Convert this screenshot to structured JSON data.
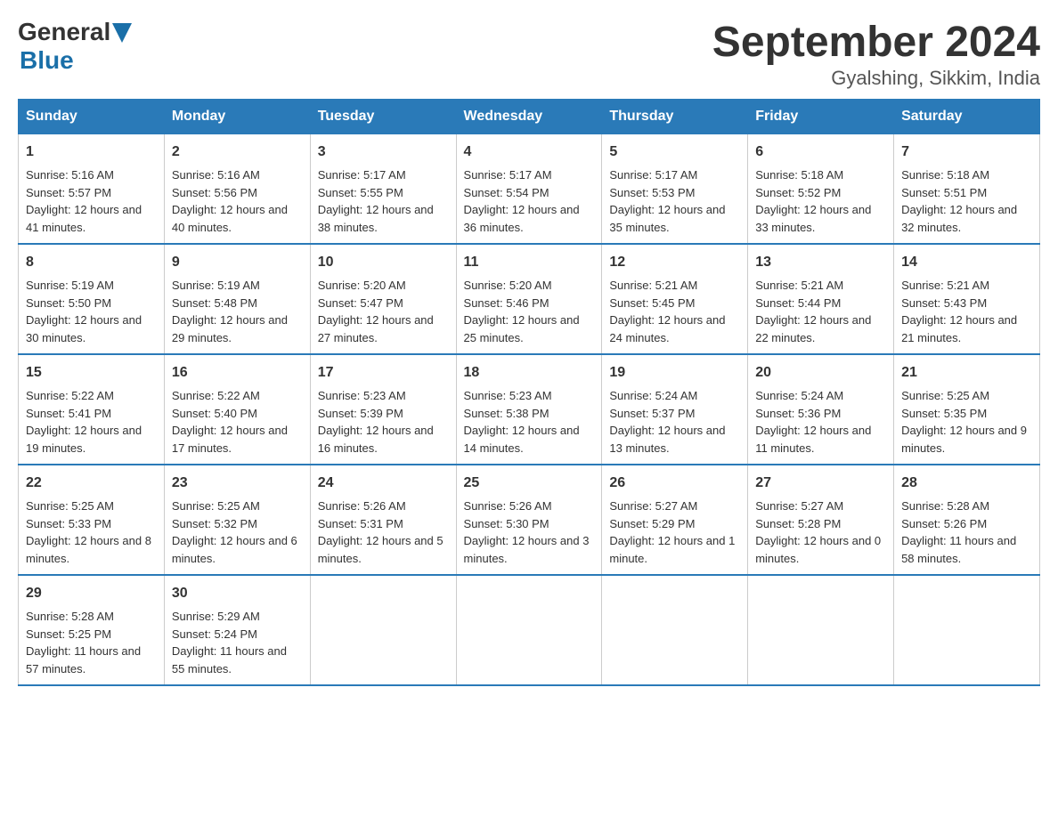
{
  "header": {
    "logo_general": "General",
    "logo_blue": "Blue",
    "title": "September 2024",
    "subtitle": "Gyalshing, Sikkim, India"
  },
  "days_header": [
    "Sunday",
    "Monday",
    "Tuesday",
    "Wednesday",
    "Thursday",
    "Friday",
    "Saturday"
  ],
  "weeks": [
    [
      {
        "day": "1",
        "sunrise": "Sunrise: 5:16 AM",
        "sunset": "Sunset: 5:57 PM",
        "daylight": "Daylight: 12 hours and 41 minutes."
      },
      {
        "day": "2",
        "sunrise": "Sunrise: 5:16 AM",
        "sunset": "Sunset: 5:56 PM",
        "daylight": "Daylight: 12 hours and 40 minutes."
      },
      {
        "day": "3",
        "sunrise": "Sunrise: 5:17 AM",
        "sunset": "Sunset: 5:55 PM",
        "daylight": "Daylight: 12 hours and 38 minutes."
      },
      {
        "day": "4",
        "sunrise": "Sunrise: 5:17 AM",
        "sunset": "Sunset: 5:54 PM",
        "daylight": "Daylight: 12 hours and 36 minutes."
      },
      {
        "day": "5",
        "sunrise": "Sunrise: 5:17 AM",
        "sunset": "Sunset: 5:53 PM",
        "daylight": "Daylight: 12 hours and 35 minutes."
      },
      {
        "day": "6",
        "sunrise": "Sunrise: 5:18 AM",
        "sunset": "Sunset: 5:52 PM",
        "daylight": "Daylight: 12 hours and 33 minutes."
      },
      {
        "day": "7",
        "sunrise": "Sunrise: 5:18 AM",
        "sunset": "Sunset: 5:51 PM",
        "daylight": "Daylight: 12 hours and 32 minutes."
      }
    ],
    [
      {
        "day": "8",
        "sunrise": "Sunrise: 5:19 AM",
        "sunset": "Sunset: 5:50 PM",
        "daylight": "Daylight: 12 hours and 30 minutes."
      },
      {
        "day": "9",
        "sunrise": "Sunrise: 5:19 AM",
        "sunset": "Sunset: 5:48 PM",
        "daylight": "Daylight: 12 hours and 29 minutes."
      },
      {
        "day": "10",
        "sunrise": "Sunrise: 5:20 AM",
        "sunset": "Sunset: 5:47 PM",
        "daylight": "Daylight: 12 hours and 27 minutes."
      },
      {
        "day": "11",
        "sunrise": "Sunrise: 5:20 AM",
        "sunset": "Sunset: 5:46 PM",
        "daylight": "Daylight: 12 hours and 25 minutes."
      },
      {
        "day": "12",
        "sunrise": "Sunrise: 5:21 AM",
        "sunset": "Sunset: 5:45 PM",
        "daylight": "Daylight: 12 hours and 24 minutes."
      },
      {
        "day": "13",
        "sunrise": "Sunrise: 5:21 AM",
        "sunset": "Sunset: 5:44 PM",
        "daylight": "Daylight: 12 hours and 22 minutes."
      },
      {
        "day": "14",
        "sunrise": "Sunrise: 5:21 AM",
        "sunset": "Sunset: 5:43 PM",
        "daylight": "Daylight: 12 hours and 21 minutes."
      }
    ],
    [
      {
        "day": "15",
        "sunrise": "Sunrise: 5:22 AM",
        "sunset": "Sunset: 5:41 PM",
        "daylight": "Daylight: 12 hours and 19 minutes."
      },
      {
        "day": "16",
        "sunrise": "Sunrise: 5:22 AM",
        "sunset": "Sunset: 5:40 PM",
        "daylight": "Daylight: 12 hours and 17 minutes."
      },
      {
        "day": "17",
        "sunrise": "Sunrise: 5:23 AM",
        "sunset": "Sunset: 5:39 PM",
        "daylight": "Daylight: 12 hours and 16 minutes."
      },
      {
        "day": "18",
        "sunrise": "Sunrise: 5:23 AM",
        "sunset": "Sunset: 5:38 PM",
        "daylight": "Daylight: 12 hours and 14 minutes."
      },
      {
        "day": "19",
        "sunrise": "Sunrise: 5:24 AM",
        "sunset": "Sunset: 5:37 PM",
        "daylight": "Daylight: 12 hours and 13 minutes."
      },
      {
        "day": "20",
        "sunrise": "Sunrise: 5:24 AM",
        "sunset": "Sunset: 5:36 PM",
        "daylight": "Daylight: 12 hours and 11 minutes."
      },
      {
        "day": "21",
        "sunrise": "Sunrise: 5:25 AM",
        "sunset": "Sunset: 5:35 PM",
        "daylight": "Daylight: 12 hours and 9 minutes."
      }
    ],
    [
      {
        "day": "22",
        "sunrise": "Sunrise: 5:25 AM",
        "sunset": "Sunset: 5:33 PM",
        "daylight": "Daylight: 12 hours and 8 minutes."
      },
      {
        "day": "23",
        "sunrise": "Sunrise: 5:25 AM",
        "sunset": "Sunset: 5:32 PM",
        "daylight": "Daylight: 12 hours and 6 minutes."
      },
      {
        "day": "24",
        "sunrise": "Sunrise: 5:26 AM",
        "sunset": "Sunset: 5:31 PM",
        "daylight": "Daylight: 12 hours and 5 minutes."
      },
      {
        "day": "25",
        "sunrise": "Sunrise: 5:26 AM",
        "sunset": "Sunset: 5:30 PM",
        "daylight": "Daylight: 12 hours and 3 minutes."
      },
      {
        "day": "26",
        "sunrise": "Sunrise: 5:27 AM",
        "sunset": "Sunset: 5:29 PM",
        "daylight": "Daylight: 12 hours and 1 minute."
      },
      {
        "day": "27",
        "sunrise": "Sunrise: 5:27 AM",
        "sunset": "Sunset: 5:28 PM",
        "daylight": "Daylight: 12 hours and 0 minutes."
      },
      {
        "day": "28",
        "sunrise": "Sunrise: 5:28 AM",
        "sunset": "Sunset: 5:26 PM",
        "daylight": "Daylight: 11 hours and 58 minutes."
      }
    ],
    [
      {
        "day": "29",
        "sunrise": "Sunrise: 5:28 AM",
        "sunset": "Sunset: 5:25 PM",
        "daylight": "Daylight: 11 hours and 57 minutes."
      },
      {
        "day": "30",
        "sunrise": "Sunrise: 5:29 AM",
        "sunset": "Sunset: 5:24 PM",
        "daylight": "Daylight: 11 hours and 55 minutes."
      },
      null,
      null,
      null,
      null,
      null
    ]
  ]
}
